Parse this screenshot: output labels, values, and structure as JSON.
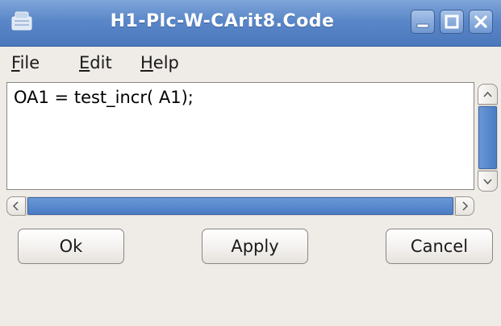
{
  "window": {
    "title": "H1-Plc-W-CArit8.Code",
    "app_icon": "window-app-icon",
    "accent_color": "#5a87c8"
  },
  "menu": {
    "file": {
      "underline": "F",
      "rest": "ile"
    },
    "edit": {
      "underline": "E",
      "rest": "dit"
    },
    "help": {
      "underline": "H",
      "rest": "elp"
    }
  },
  "editor": {
    "content": "OA1 = test_incr( A1);"
  },
  "buttons": {
    "ok": "Ok",
    "apply": "Apply",
    "cancel": "Cancel"
  }
}
